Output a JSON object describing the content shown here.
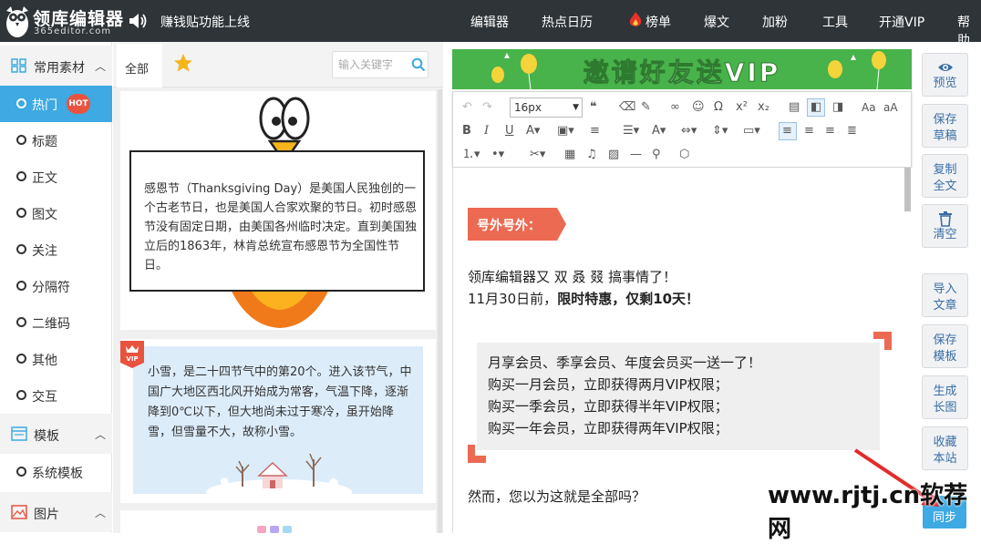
{
  "app": {
    "brand": "领库编辑器",
    "brand_sub": "365editor.com",
    "notice": "赚钱贴功能上线"
  },
  "nav": {
    "items": [
      "编辑器",
      "热点日历",
      "榜单",
      "爆文",
      "加粉",
      "工具",
      "开通VIP",
      "帮助"
    ]
  },
  "left_nav": {
    "sections": [
      {
        "label": "常用素材",
        "icon": "grid-icon"
      },
      {
        "label": "模板",
        "icon": "template-icon"
      },
      {
        "label": "图片",
        "icon": "image-icon"
      }
    ],
    "common_items": [
      "热门",
      "标题",
      "正文",
      "图文",
      "关注",
      "分隔符",
      "二维码",
      "其他",
      "交互"
    ],
    "hot_badge": "HOT",
    "template_items": [
      "系统模板"
    ]
  },
  "panel": {
    "tab_all": "全部",
    "search_placeholder": "输入关键字",
    "card1_text": "感恩节（Thanksgiving Day）是美国人民独创的一个古老节日，也是美国人合家欢聚的节日。初时感恩节没有固定日期，由美国各州临时决定。直到美国独立后的1863年，林肯总统宣布感恩节为全国性节日。",
    "card2_badge": "VIP",
    "card2_text": "小雪，是二十四节气中的第20个。进入该节气，中国广大地区西北风开始成为常客，气温下降，逐渐降到0℃以下，但大地尚未过于寒冷，虽开始降雪，但雪量不大，故称小雪。"
  },
  "editor": {
    "banner": "邀请好友送VIP",
    "font_size": "16px",
    "tag": "号外号外：",
    "p1_line1": "领库编辑器又 双 叒 叕  搞事情了！",
    "p1_line2_prefix": "11月30日前，",
    "p1_line2_bold": "限时特惠，仅剩10天！",
    "quote": [
      "月享会员、季享会员、年度会员买一送一了！",
      "购买一月会员，立即获得两月VIP权限；",
      "购买一季会员，立即获得半年VIP权限；",
      "购买一年会员，立即获得两年VIP权限；"
    ],
    "p2": "然而，您以为这就是全部吗？"
  },
  "right_bar": {
    "buttons": [
      {
        "label": "预览",
        "icon": "eye-icon"
      },
      {
        "label": "保存草稿"
      },
      {
        "label": "复制全文"
      },
      {
        "label": "清空",
        "icon": "trash-icon"
      },
      {
        "label": "导入文章"
      },
      {
        "label": "保存模板"
      },
      {
        "label": "生成长图"
      },
      {
        "label": "收藏本站"
      }
    ],
    "sync": "同步"
  },
  "watermark": "www.rjtj.cn软荐网",
  "colors": {
    "topbar": "#2f3438",
    "accent": "#3ea9e2",
    "hot": "#e8533f",
    "banner": "#47b34a",
    "tag": "#ec6a52"
  }
}
